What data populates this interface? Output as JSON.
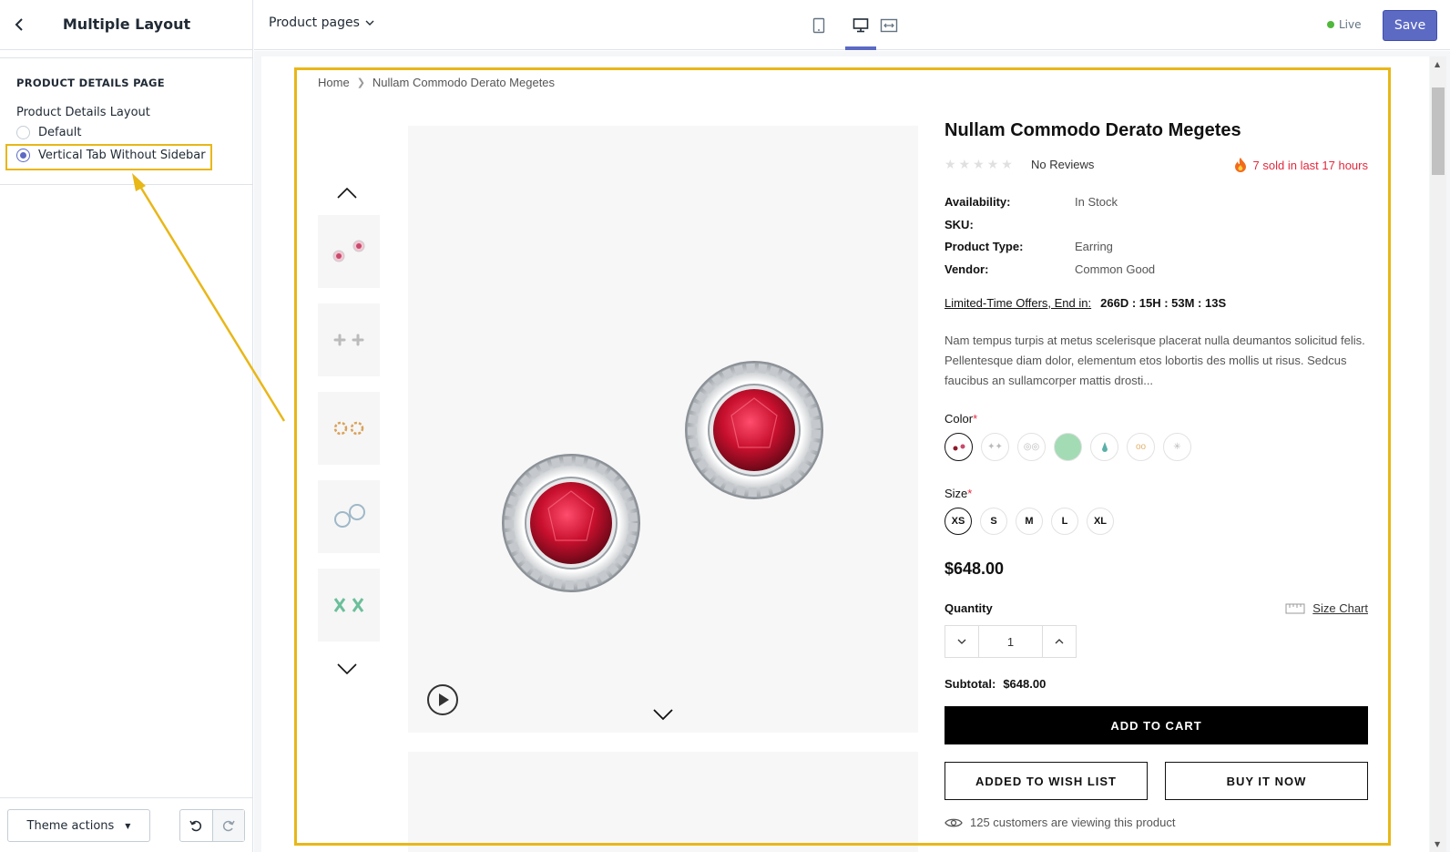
{
  "sidebar": {
    "title": "Multiple Layout",
    "section_title": "PRODUCT DETAILS PAGE",
    "layout_label": "Product Details Layout",
    "options": [
      {
        "label": "Default",
        "checked": false
      },
      {
        "label": "Vertical Tab Without Sidebar",
        "checked": true
      }
    ],
    "theme_actions_label": "Theme actions"
  },
  "topbar": {
    "page_select": "Product pages",
    "live_label": "Live",
    "save_label": "Save",
    "active_view": "desktop"
  },
  "store": {
    "breadcrumb": [
      "Home",
      "Nullam Commodo Derato Megetes"
    ],
    "product": {
      "title": "Nullam Commodo Derato Megetes",
      "reviews": "No Reviews",
      "rating": 0,
      "sold_text": "7 sold in last 17 hours",
      "specs": [
        {
          "key": "Availability:",
          "value": "In Stock"
        },
        {
          "key": "SKU:",
          "value": ""
        },
        {
          "key": "Product Type:",
          "value": "Earring"
        },
        {
          "key": "Vendor:",
          "value": "Common Good"
        }
      ],
      "offer_label": "Limited-Time Offers, End in:",
      "offer_timer": "266D : 15H : 53M : 13S",
      "description": "Nam tempus turpis at metus scelerisque placerat nulla deumantos solicitud felis. Pellentesque diam dolor, elementum etos lobortis des mollis ut risus. Sedcus faucibus an sullamcorper mattis drosti...",
      "color_label": "Color",
      "size_label": "Size",
      "required_mark": "*",
      "sizes": [
        "XS",
        "S",
        "M",
        "L",
        "XL"
      ],
      "price": "$648.00",
      "quantity_label": "Quantity",
      "size_chart": "Size Chart",
      "quantity": "1",
      "subtotal_label": "Subtotal:",
      "subtotal_value": "$648.00",
      "add_to_cart": "ADD TO CART",
      "wishlist": "ADDED TO WISH LIST",
      "buy_now": "BUY IT NOW",
      "viewers": "125 customers are viewing this product"
    }
  },
  "colors": {
    "accent": "#5c6ac4",
    "highlight": "#e8b718",
    "sold": "#e4293e",
    "live": "#50b83c"
  }
}
